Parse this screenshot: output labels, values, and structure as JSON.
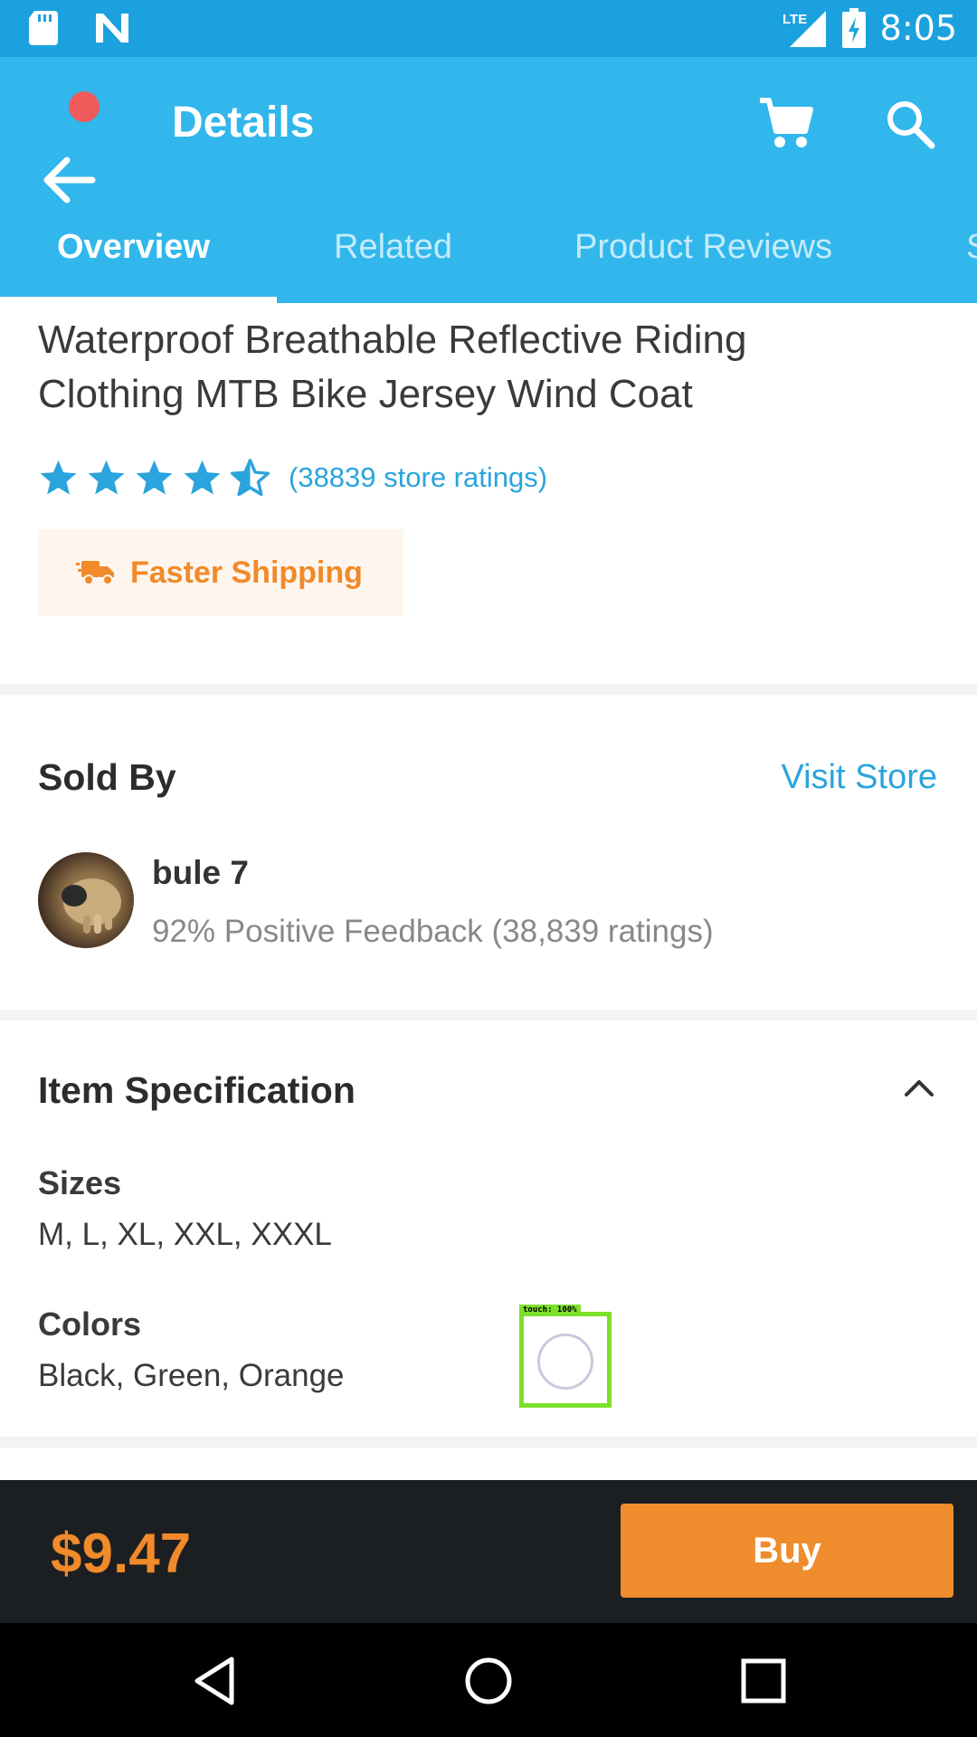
{
  "status_bar": {
    "time": "8:05",
    "network_label": "LTE"
  },
  "app_bar": {
    "title": "Details"
  },
  "tabs": [
    {
      "label": "Overview",
      "active": true
    },
    {
      "label": "Related",
      "active": false
    },
    {
      "label": "Product Reviews",
      "active": false
    },
    {
      "label": "S",
      "active": false
    }
  ],
  "product": {
    "title_line1": "Waterproof Breathable Reflective Riding",
    "title_line2": "Clothing MTB Bike Jersey Wind Coat",
    "rating_stars": 4.5,
    "rating_text": "(38839 store ratings)",
    "shipping_badge": "Faster Shipping"
  },
  "seller": {
    "section_title": "Sold By",
    "visit_store": "Visit Store",
    "name": "bule 7",
    "feedback": "92% Positive Feedback (38,839 ratings)"
  },
  "specification": {
    "section_title": "Item Specification",
    "items": [
      {
        "label": "Sizes",
        "value": "M, L, XL, XXL, XXXL"
      },
      {
        "label": "Colors",
        "value": "Black, Green, Orange"
      }
    ]
  },
  "touch_indicator": {
    "label": "touch: 100%"
  },
  "bottom_bar": {
    "price": "$9.47",
    "buy_label": "Buy"
  },
  "colors": {
    "status_bar": "#1ca1df",
    "app_bar": "#31b7ec",
    "accent_orange": "#f08a2a",
    "link_blue": "#2aa4dc",
    "star_blue": "#2aa4dc"
  }
}
